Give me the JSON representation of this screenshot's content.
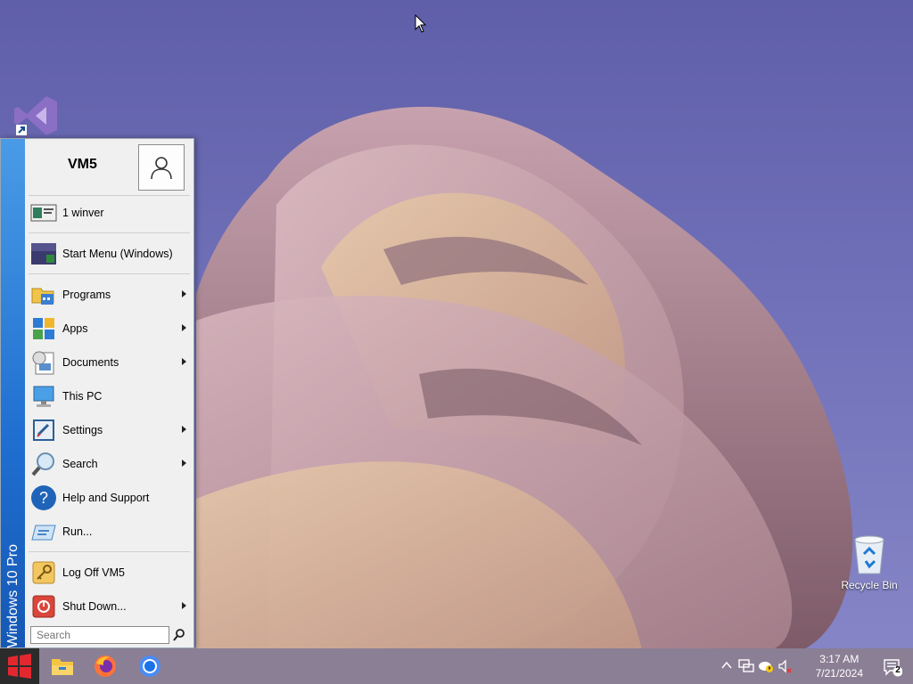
{
  "desktop": {
    "recycle_bin_label": "Recycle Bin"
  },
  "start_menu": {
    "banner_text": "Windows 10 Pro",
    "user_name": "VM5",
    "recent_item": "1 winver",
    "pinned_item": "Start Menu (Windows)",
    "items": [
      {
        "label": "Programs",
        "icon": "programs-icon",
        "submenu": true
      },
      {
        "label": "Apps",
        "icon": "apps-icon",
        "submenu": true
      },
      {
        "label": "Documents",
        "icon": "documents-icon",
        "submenu": true
      },
      {
        "label": "This PC",
        "icon": "computer-icon",
        "submenu": false
      },
      {
        "label": "Settings",
        "icon": "settings-icon",
        "submenu": true
      },
      {
        "label": "Search",
        "icon": "search-icon",
        "submenu": true
      },
      {
        "label": "Help and Support",
        "icon": "help-icon",
        "submenu": false
      },
      {
        "label": "Run...",
        "icon": "run-icon",
        "submenu": false
      }
    ],
    "logoff_label": "Log Off VM5",
    "shutdown_label": "Shut Down...",
    "search_placeholder": "Search"
  },
  "taskbar": {
    "apps": [
      "file-explorer-icon",
      "firefox-icon",
      "chrome-icon"
    ],
    "clock_time": "3:17 AM",
    "clock_date": "7/21/2024",
    "notification_count": "2"
  },
  "colors": {
    "banner": "#1f6ed0",
    "menu_bg": "#f0f0f0",
    "desktop_bg": "#6f6fb8"
  }
}
